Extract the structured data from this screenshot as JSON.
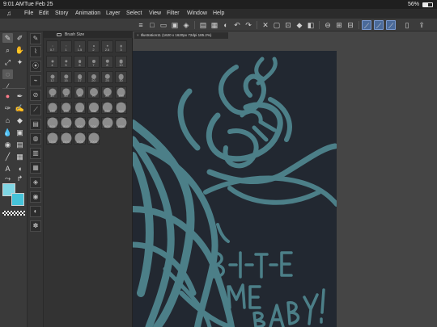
{
  "status": {
    "time": "9:01 AM",
    "date": "Tue Feb 25",
    "battery_text": "56%",
    "battery_level": 0.56
  },
  "menu": [
    "File",
    "Edit",
    "Story",
    "Animation",
    "Layer",
    "Select",
    "View",
    "Filter",
    "Window",
    "Help"
  ],
  "palette": {
    "title": "Brush Size",
    "sizes": [
      [
        "0.7",
        "1",
        "1.5",
        "2",
        "2.5",
        "3"
      ],
      [
        "4",
        "5",
        "6",
        "7",
        "8",
        "10"
      ],
      [
        "12",
        "15",
        "17",
        "20",
        "25",
        "30"
      ],
      [
        "40",
        "50",
        "60",
        "70",
        "80",
        "100"
      ],
      [
        "120",
        "150",
        "170",
        "200",
        "250",
        "300"
      ],
      [
        "400",
        "500",
        "600",
        "700",
        "800",
        "1000"
      ],
      [
        "1200",
        "1500",
        "1700",
        "2000"
      ]
    ]
  },
  "document": {
    "tab_label": "Illustration11 (1620 x 1620px 72dpi 185.2%)",
    "close_glyph": "×"
  },
  "colors": {
    "main": "#7fd6e4",
    "sub": "#45c3d9",
    "artwork_background": "#222831",
    "stroke": "#6fc6cf"
  },
  "artwork_text": [
    "B-I-T-E",
    "ME",
    "BABY!"
  ]
}
